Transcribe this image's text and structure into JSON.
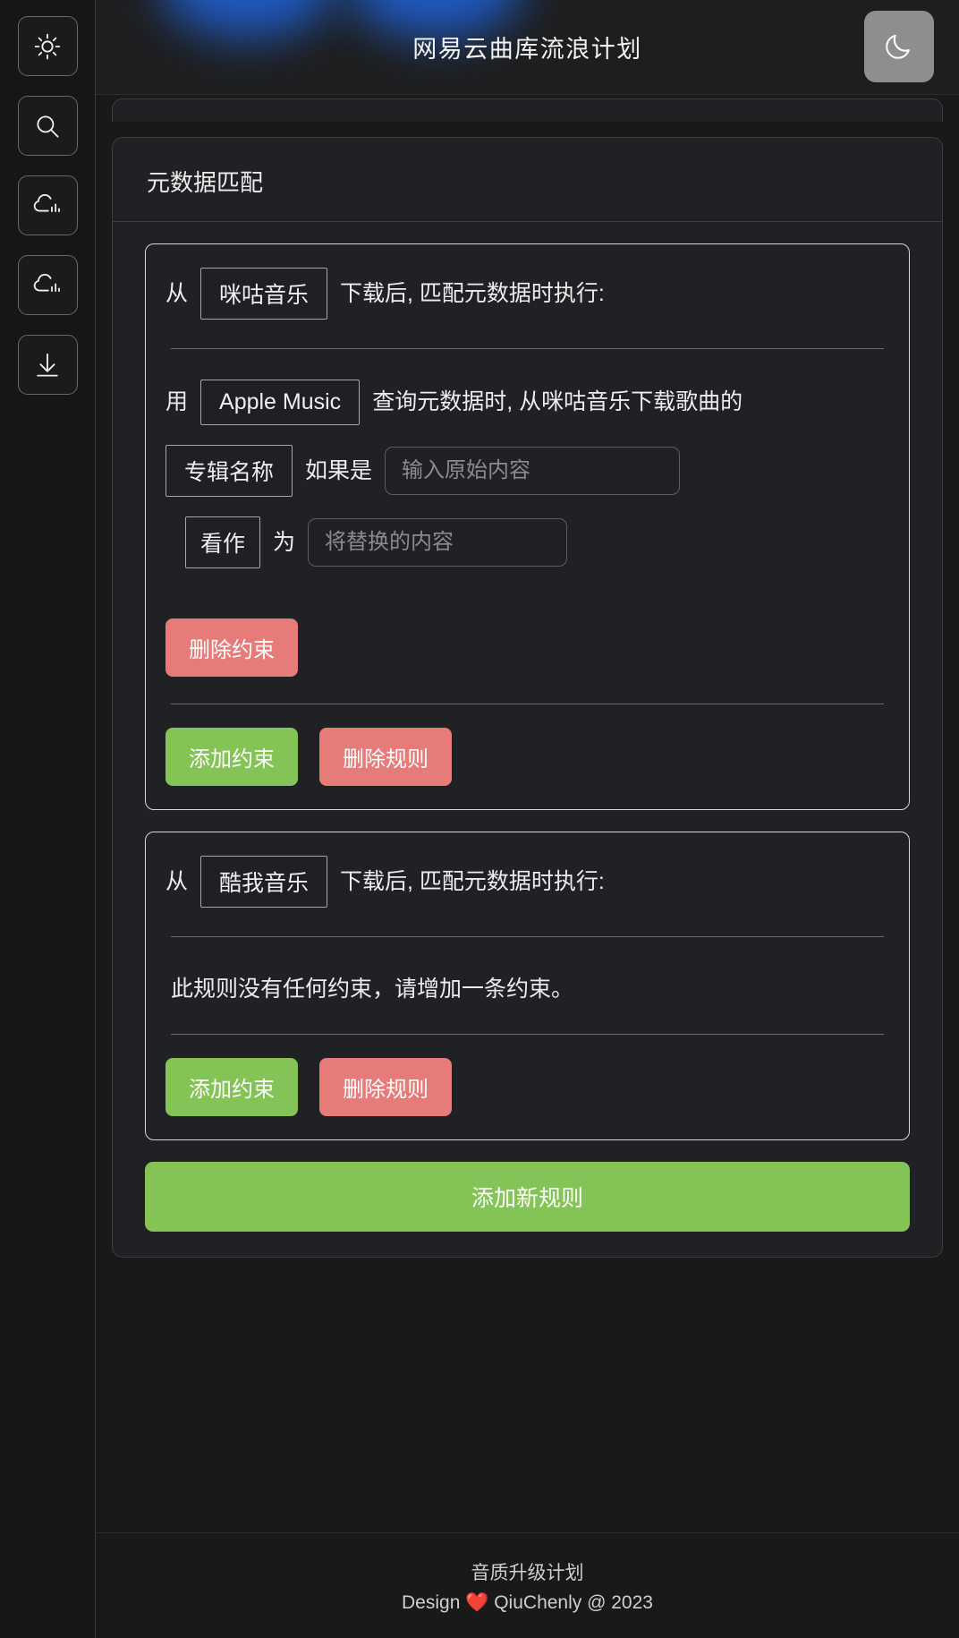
{
  "window": {
    "title": "网易云曲库流浪计划",
    "theme_toggle_icon": "moon-icon",
    "theme_toggle_label": "深色模式"
  },
  "sidebar": {
    "items": [
      {
        "icon": "sun-icon",
        "label": "亮度"
      },
      {
        "icon": "search-icon",
        "label": "搜索"
      },
      {
        "icon": "cloud-chart-icon",
        "label": "音乐云盘"
      },
      {
        "icon": "cloud-chart-icon-2",
        "label": "音乐云盘"
      },
      {
        "icon": "download-icon",
        "label": "下载"
      }
    ]
  },
  "panel": {
    "title": "元数据匹配",
    "add_rule_label": "添加新规则"
  },
  "rules": [
    {
      "prefix": "从",
      "source": "咪咕音乐",
      "suffix": "下载后, 匹配元数据时执行:",
      "has_constraints": true,
      "constraint": {
        "seg1": "用",
        "provider": "Apple Music",
        "seg2": "查询元数据时, 从咪咕音乐下载歌曲的",
        "field": "专辑名称",
        "seg3": "如果是",
        "original_value": "",
        "original_placeholder": "输入原始内容",
        "operator": "看作",
        "seg4": "为",
        "replace_value": "",
        "replace_placeholder": "将替换的内容",
        "delete_constraint_label": "删除约束"
      },
      "add_constraint_label": "添加约束",
      "delete_rule_label": "删除规则"
    },
    {
      "prefix": "从",
      "source": "酷我音乐",
      "suffix": "下载后, 匹配元数据时执行:",
      "has_constraints": false,
      "empty_note": "此规则没有任何约束，请增加一条约束。",
      "add_constraint_label": "添加约束",
      "delete_rule_label": "删除规则"
    }
  ],
  "footer": {
    "line1": "音质升级计划",
    "design_prefix": "Design",
    "heart": "❤️",
    "design_suffix": "QiuChenly @ 2023"
  },
  "colors": {
    "green": "#84c457",
    "red": "#e77b79",
    "background": "#191919",
    "panel": "#202124",
    "accent_glow": "#1f5fd0"
  }
}
